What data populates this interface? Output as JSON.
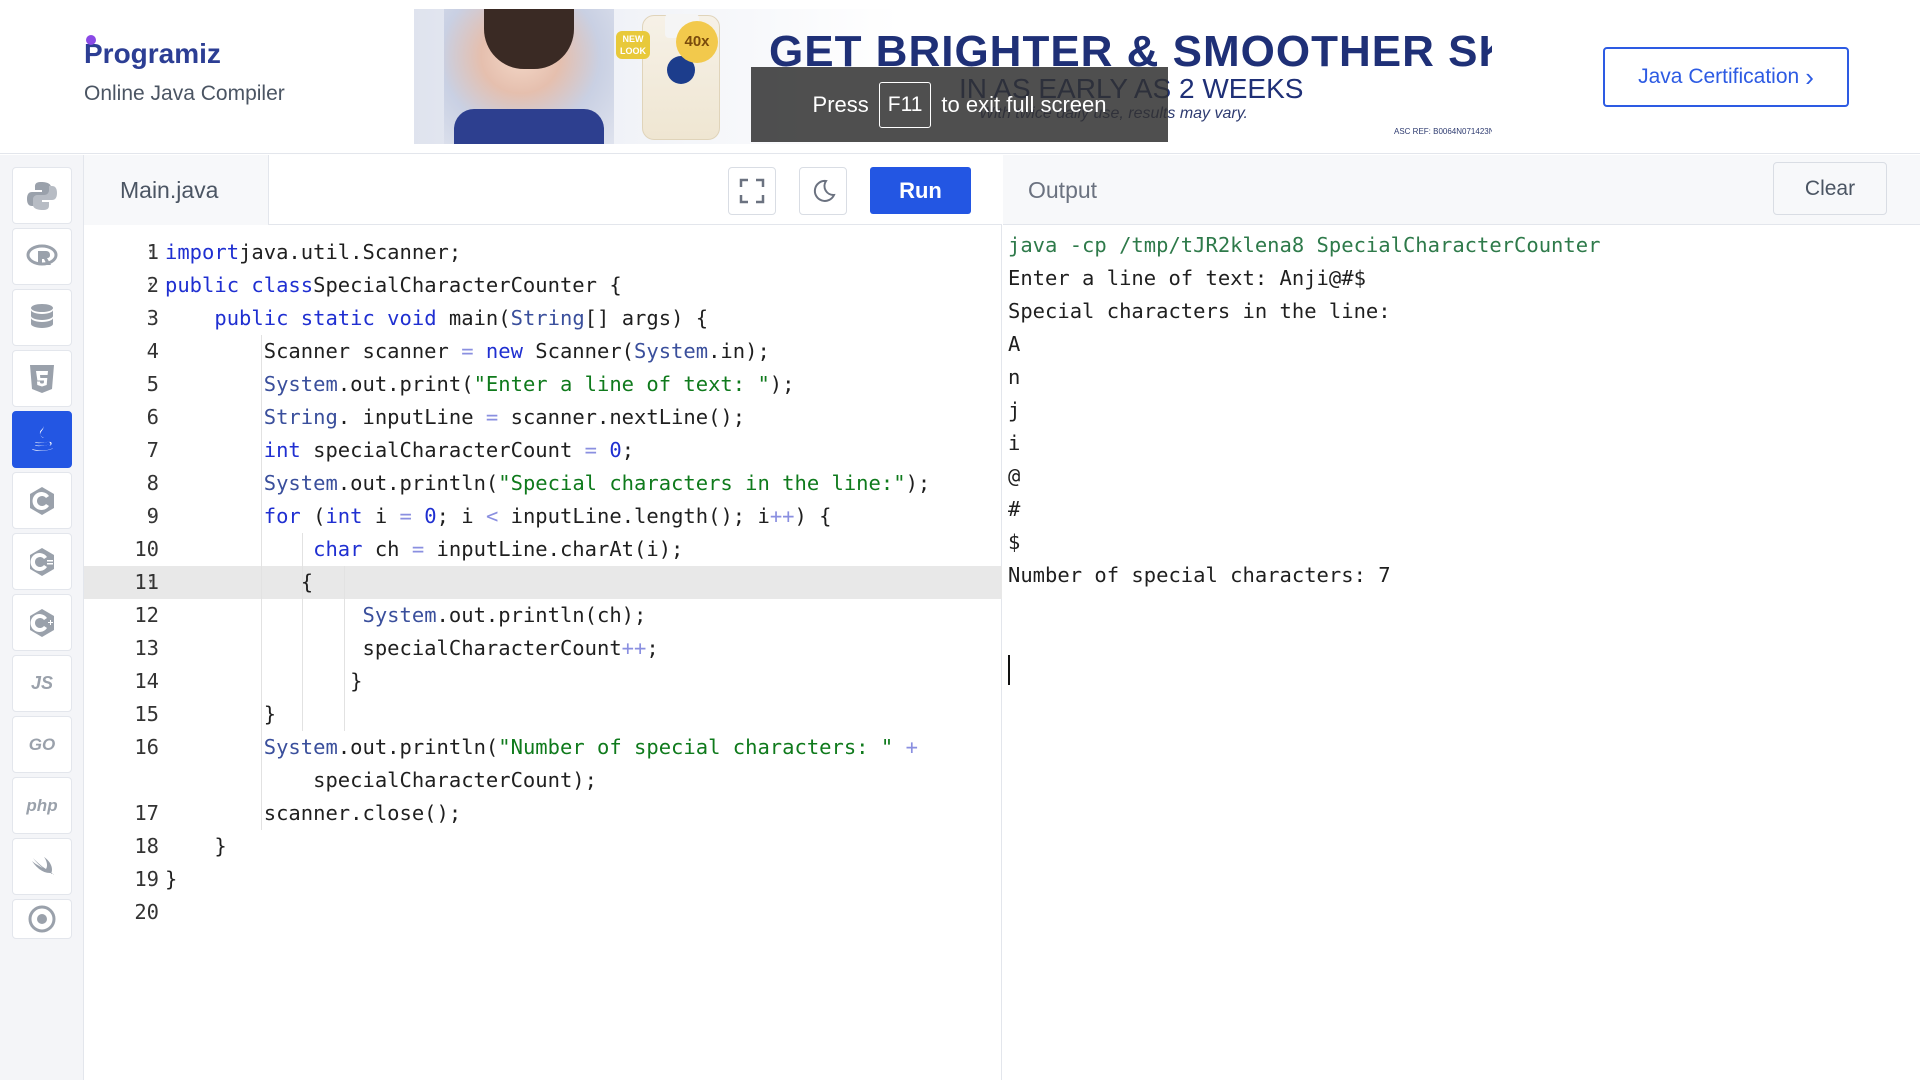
{
  "header": {
    "logo_text": "Programiz",
    "subtitle": "Online Java Compiler",
    "ad": {
      "badge": "NEW LOOK",
      "badge_40x": "40x",
      "title": "GET BRIGHTER & SMOOTHER SKIN",
      "subtitle": "IN AS EARLY AS 2 WEEKS",
      "small": "With twice daily use, results may vary.",
      "ref": "ASC REF: B0064N071423N"
    },
    "fullscreen_notice": {
      "before": "Press",
      "key": "F11",
      "after": "to exit full screen"
    },
    "certification_button": "Java Certification",
    "certification_chevron": "›"
  },
  "sidebar": {
    "items": [
      {
        "name": "python",
        "icon": "python-icon",
        "label": ""
      },
      {
        "name": "r",
        "icon": "r-icon",
        "label": ""
      },
      {
        "name": "sql",
        "icon": "database-icon",
        "label": ""
      },
      {
        "name": "html",
        "icon": "html5-icon",
        "label": ""
      },
      {
        "name": "java",
        "icon": "java-icon",
        "label": "",
        "active": true
      },
      {
        "name": "c",
        "icon": "c-icon",
        "label": ""
      },
      {
        "name": "csharp",
        "icon": "csharp-icon",
        "label": ""
      },
      {
        "name": "cpp",
        "icon": "cpp-icon",
        "label": ""
      },
      {
        "name": "js",
        "icon": "js-icon",
        "label": "JS"
      },
      {
        "name": "go",
        "icon": "go-icon",
        "label": "GO"
      },
      {
        "name": "php",
        "icon": "php-icon",
        "label": "php"
      },
      {
        "name": "swift",
        "icon": "swift-icon",
        "label": ""
      },
      {
        "name": "rust",
        "icon": "rust-icon",
        "label": ""
      }
    ]
  },
  "editor": {
    "file_tab": "Main.java",
    "run_label": "Run",
    "active_line": 11,
    "lines": [
      {
        "n": "1",
        "fold": true,
        "tokens": [
          [
            "kw",
            "import"
          ],
          [
            "",
            "java.util.Scanner;"
          ]
        ]
      },
      {
        "n": "2",
        "fold": true,
        "tokens": [
          [
            "kw",
            "public class"
          ],
          [
            "",
            "SpecialCharacterCounter {"
          ]
        ]
      },
      {
        "n": "3",
        "fold": true,
        "tokens": [
          [
            "",
            "    "
          ],
          [
            "kw",
            "public static void"
          ],
          [
            "",
            " main("
          ],
          [
            "ty",
            "String"
          ],
          [
            "",
            "[] args) {"
          ]
        ]
      },
      {
        "n": "4",
        "tokens": [
          [
            "",
            "        Scanner scanner "
          ],
          [
            "op",
            "="
          ],
          [
            " kw",
            "new"
          ],
          [
            "",
            " Scanner("
          ],
          [
            "ty",
            "System"
          ],
          [
            "",
            ".in);"
          ]
        ]
      },
      {
        "n": "5",
        "tokens": [
          [
            "",
            "        "
          ],
          [
            "ty",
            "System"
          ],
          [
            "",
            ".out.print("
          ],
          [
            "str",
            "\"Enter a line of text: \""
          ],
          [
            "",
            ");"
          ]
        ]
      },
      {
        "n": "6",
        "tokens": [
          [
            "",
            "        "
          ],
          [
            "ty",
            "String"
          ],
          [
            "",
            ". inputLine "
          ],
          [
            "op",
            "="
          ],
          [
            "",
            " scanner.nextLine();"
          ]
        ]
      },
      {
        "n": "7",
        "tokens": [
          [
            "",
            "        "
          ],
          [
            "kw",
            "int"
          ],
          [
            "",
            " specialCharacterCount "
          ],
          [
            "op",
            "="
          ],
          [
            " num",
            "0"
          ],
          [
            "",
            ";"
          ]
        ]
      },
      {
        "n": "8",
        "tokens": [
          [
            "",
            "        "
          ],
          [
            "ty",
            "System"
          ],
          [
            "",
            ".out.println("
          ],
          [
            "str",
            "\"Special characters in the line:\""
          ],
          [
            "",
            ");"
          ]
        ]
      },
      {
        "n": "9",
        "fold": true,
        "tokens": [
          [
            "",
            "        "
          ],
          [
            "kw",
            "for"
          ],
          [
            "",
            " ("
          ],
          [
            "kw",
            "int"
          ],
          [
            "",
            " i "
          ],
          [
            "op",
            "="
          ],
          [
            " num",
            "0"
          ],
          [
            "",
            "; i "
          ],
          [
            "op",
            "<"
          ],
          [
            "",
            " inputLine.length(); i"
          ],
          [
            "op",
            "++"
          ],
          [
            "",
            ") {"
          ]
        ]
      },
      {
        "n": "10",
        "tokens": [
          [
            "",
            "            "
          ],
          [
            "kw",
            "char"
          ],
          [
            "",
            " ch "
          ],
          [
            "op",
            "="
          ],
          [
            "",
            " inputLine.charAt(i);"
          ]
        ]
      },
      {
        "n": "11",
        "fold": true,
        "tokens": [
          [
            "",
            "           {"
          ]
        ]
      },
      {
        "n": "12",
        "tokens": [
          [
            "",
            "                "
          ],
          [
            "ty",
            "System"
          ],
          [
            "",
            ".out.println(ch);"
          ]
        ]
      },
      {
        "n": "13",
        "tokens": [
          [
            "",
            "                specialCharacterCount"
          ],
          [
            "op",
            "++"
          ],
          [
            "",
            ";"
          ]
        ]
      },
      {
        "n": "14",
        "tokens": [
          [
            "",
            "               }"
          ]
        ]
      },
      {
        "n": "15",
        "tokens": [
          [
            "",
            "        }"
          ]
        ]
      },
      {
        "n": "16",
        "tokens": [
          [
            "",
            "        "
          ],
          [
            "ty",
            "System"
          ],
          [
            "",
            ".out.println("
          ],
          [
            "str",
            "\"Number of special characters: \""
          ],
          [
            " op",
            "+"
          ]
        ]
      },
      {
        "n": "",
        "tokens": [
          [
            "",
            "            specialCharacterCount);"
          ]
        ]
      },
      {
        "n": "17",
        "tokens": [
          [
            "",
            "        scanner.close();"
          ]
        ]
      },
      {
        "n": "18",
        "tokens": [
          [
            "",
            "    }"
          ]
        ]
      },
      {
        "n": "19",
        "tokens": [
          [
            "",
            "}"
          ]
        ]
      },
      {
        "n": "20",
        "tokens": [
          [
            "",
            ""
          ]
        ]
      }
    ]
  },
  "output": {
    "label": "Output",
    "clear_label": "Clear",
    "command": "java -cp /tmp/tJR2klena8 SpecialCharacterCounter",
    "lines": [
      "Enter a line of text: Anji@#$",
      "Special characters in the line:",
      "A",
      "n",
      "j",
      "i",
      "@",
      "#",
      "$",
      "Number of special characters: 7"
    ]
  }
}
